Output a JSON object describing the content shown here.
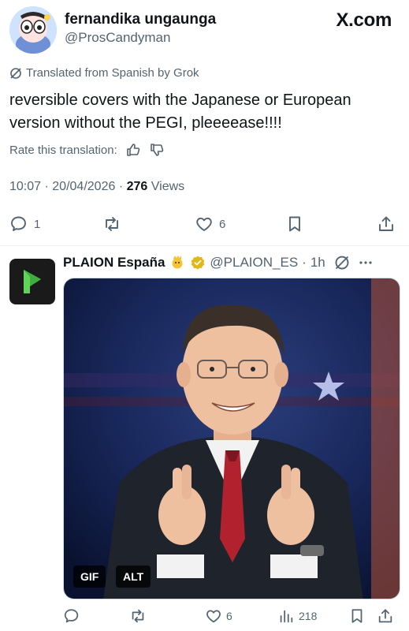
{
  "header": {
    "site": "X.com"
  },
  "post": {
    "author_name": "fernandika ungaunga",
    "author_handle": "@ProsCandyman",
    "translated_label": "Translated from Spanish by Grok",
    "text": "reversible covers with the Japanese or European version without the PEGI, pleeeease!!!!",
    "rate_label": "Rate this translation:",
    "time": "10:07",
    "date": "20/04/2026",
    "views_count": "276",
    "views_label": "Views",
    "replies": "1",
    "likes": "6"
  },
  "quoted": {
    "name": "PLAION España",
    "handle": "@PLAION_ES",
    "age": "1h",
    "gif_badge": "GIF",
    "alt_badge": "ALT",
    "likes": "6",
    "views": "218"
  },
  "colors": {
    "text": "#0f1419",
    "muted": "#536471",
    "verified": "#e2b719",
    "plaion_green": "#5fd35a"
  }
}
